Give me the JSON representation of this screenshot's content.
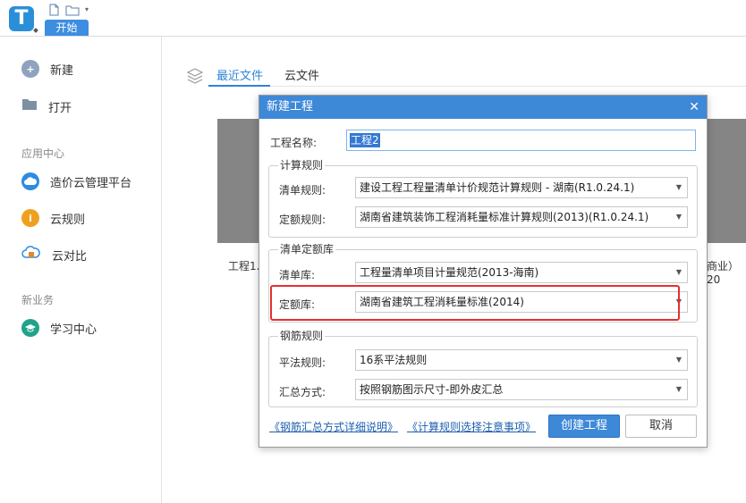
{
  "app": {
    "logo_letter": "T",
    "ribbon_tab": "开始"
  },
  "sidebar": {
    "new_label": "新建",
    "open_label": "打开",
    "section_app_center": "应用中心",
    "app_items": [
      {
        "label": "造价云管理平台",
        "icon": "cloud-icon",
        "color": "#2e8ce0"
      },
      {
        "label": "云规则",
        "icon": "info-icon",
        "color": "#f0a020"
      },
      {
        "label": "云对比",
        "icon": "cloud-compare-icon",
        "color": "#e08a2e"
      }
    ],
    "section_new_business": "新业务",
    "business_items": [
      {
        "label": "学习中心",
        "icon": "graduation-cap-icon",
        "color": "#1fa38a"
      }
    ]
  },
  "main": {
    "tabs": [
      {
        "label": "最近文件",
        "active": true
      },
      {
        "label": "云文件",
        "active": false
      }
    ],
    "recent_left_text": "工程1.",
    "recent_right_text": "商业）20"
  },
  "dialog": {
    "title": "新建工程",
    "close_glyph": "✕",
    "project_name_label": "工程名称:",
    "project_name_value": "工程2",
    "calc_rules": {
      "title": "计算规则",
      "bill_rule_label": "清单规则:",
      "bill_rule_value": "建设工程工程量清单计价规范计算规则 - 湖南(R1.0.24.1)",
      "quota_rule_label": "定额规则:",
      "quota_rule_value": "湖南省建筑装饰工程消耗量标准计算规则(2013)(R1.0.24.1)"
    },
    "bill_quota_lib": {
      "title": "清单定额库",
      "bill_lib_label": "清单库:",
      "bill_lib_value": "工程量清单项目计量规范(2013-海南)",
      "quota_lib_label": "定额库:",
      "quota_lib_value": "湖南省建筑工程消耗量标准(2014)"
    },
    "rebar_rules": {
      "title": "钢筋规则",
      "flat_rule_label": "平法规则:",
      "flat_rule_value": "16系平法规则",
      "summary_label": "汇总方式:",
      "summary_value": "按照钢筋图示尺寸-即外皮汇总"
    },
    "link_rebar_summary": "《钢筋汇总方式详细说明》",
    "link_calc_notes": "《计算规则选择注意事项》",
    "create_button": "创建工程",
    "cancel_button": "取消"
  },
  "colors": {
    "accent": "#3e88d8",
    "highlight": "#e33030"
  }
}
